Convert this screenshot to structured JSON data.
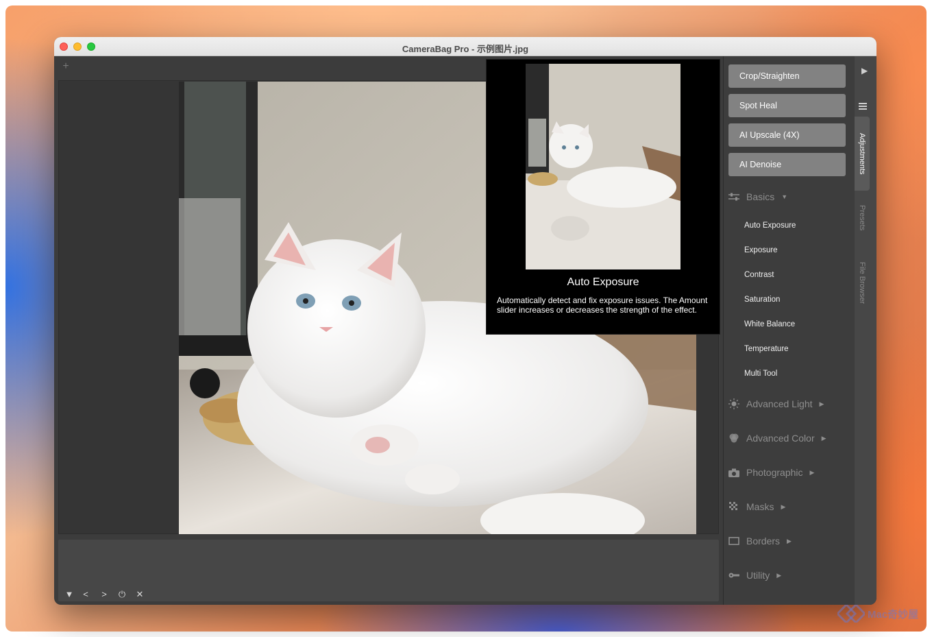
{
  "window": {
    "title": "CameraBag Pro - 示例图片.jpg"
  },
  "toolbar": {
    "add_tab_label": "+"
  },
  "tooltip": {
    "title": "Auto Exposure",
    "description": "Automatically detect and fix exposure issues. The Amount slider increases or decreases the strength of the effect."
  },
  "tools": [
    {
      "label": "Crop/Straighten"
    },
    {
      "label": "Spot Heal"
    },
    {
      "label": "AI Upscale (4X)"
    },
    {
      "label": "AI Denoise"
    }
  ],
  "basics": {
    "label": "Basics",
    "items": [
      "Auto Exposure",
      "Exposure",
      "Contrast",
      "Saturation",
      "White Balance",
      "Temperature",
      "Multi Tool"
    ]
  },
  "sections": [
    {
      "label": "Advanced Light",
      "icon": "sun-icon"
    },
    {
      "label": "Advanced Color",
      "icon": "color-circles-icon"
    },
    {
      "label": "Photographic",
      "icon": "camera-icon"
    },
    {
      "label": "Masks",
      "icon": "checker-icon"
    },
    {
      "label": "Borders",
      "icon": "border-icon"
    },
    {
      "label": "Utility",
      "icon": "wrench-icon"
    }
  ],
  "right_tabs": {
    "adjustments": "Adjustments",
    "presets": "Presets",
    "file_browser": "File Browser"
  },
  "filmstrip_controls": {
    "collapse": "▼",
    "prev": "<",
    "next": ">",
    "power": "⏻",
    "close": "✕"
  },
  "watermark": {
    "text": "Mac奇妙屋"
  }
}
